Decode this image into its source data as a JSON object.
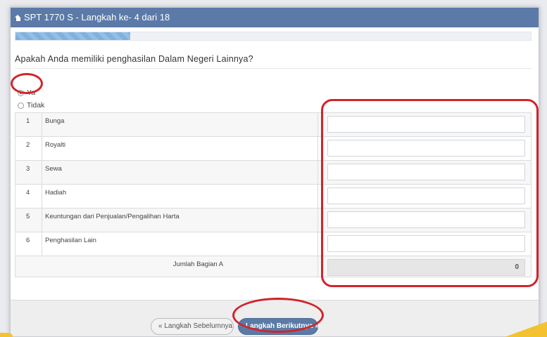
{
  "window": {
    "title": "SPT 1770 S - Langkah ke- 4 dari 18"
  },
  "progress": {
    "step": 4,
    "total": 18,
    "fraction": 0.222
  },
  "question": "Apakah Anda memiliki penghasilan Dalam Negeri Lainnya?",
  "radio_options": [
    {
      "label": "Ya",
      "checked": true
    },
    {
      "label": "Tidak",
      "checked": false
    }
  ],
  "rows": [
    {
      "no": "1",
      "label": "Bunga",
      "value": ""
    },
    {
      "no": "2",
      "label": "Royalti",
      "value": ""
    },
    {
      "no": "3",
      "label": "Sewa",
      "value": ""
    },
    {
      "no": "4",
      "label": "Hadiah",
      "value": ""
    },
    {
      "no": "5",
      "label": "Keuntungan dari Penjualan/Pengalihan Harta",
      "value": ""
    },
    {
      "no": "6",
      "label": "Penghasilan Lain",
      "value": ""
    }
  ],
  "total": {
    "label": "Jumlah Bagian A",
    "value": "0"
  },
  "buttons": {
    "prev_label": "« Langkah Sebelumnya",
    "next_label": "Langkah Berikutnya »"
  },
  "colors": {
    "titlebar": "#5b7aa8",
    "annotation": "#d0242c",
    "next_button": "#5a7ba5",
    "corner_accent": "#f2c230"
  }
}
